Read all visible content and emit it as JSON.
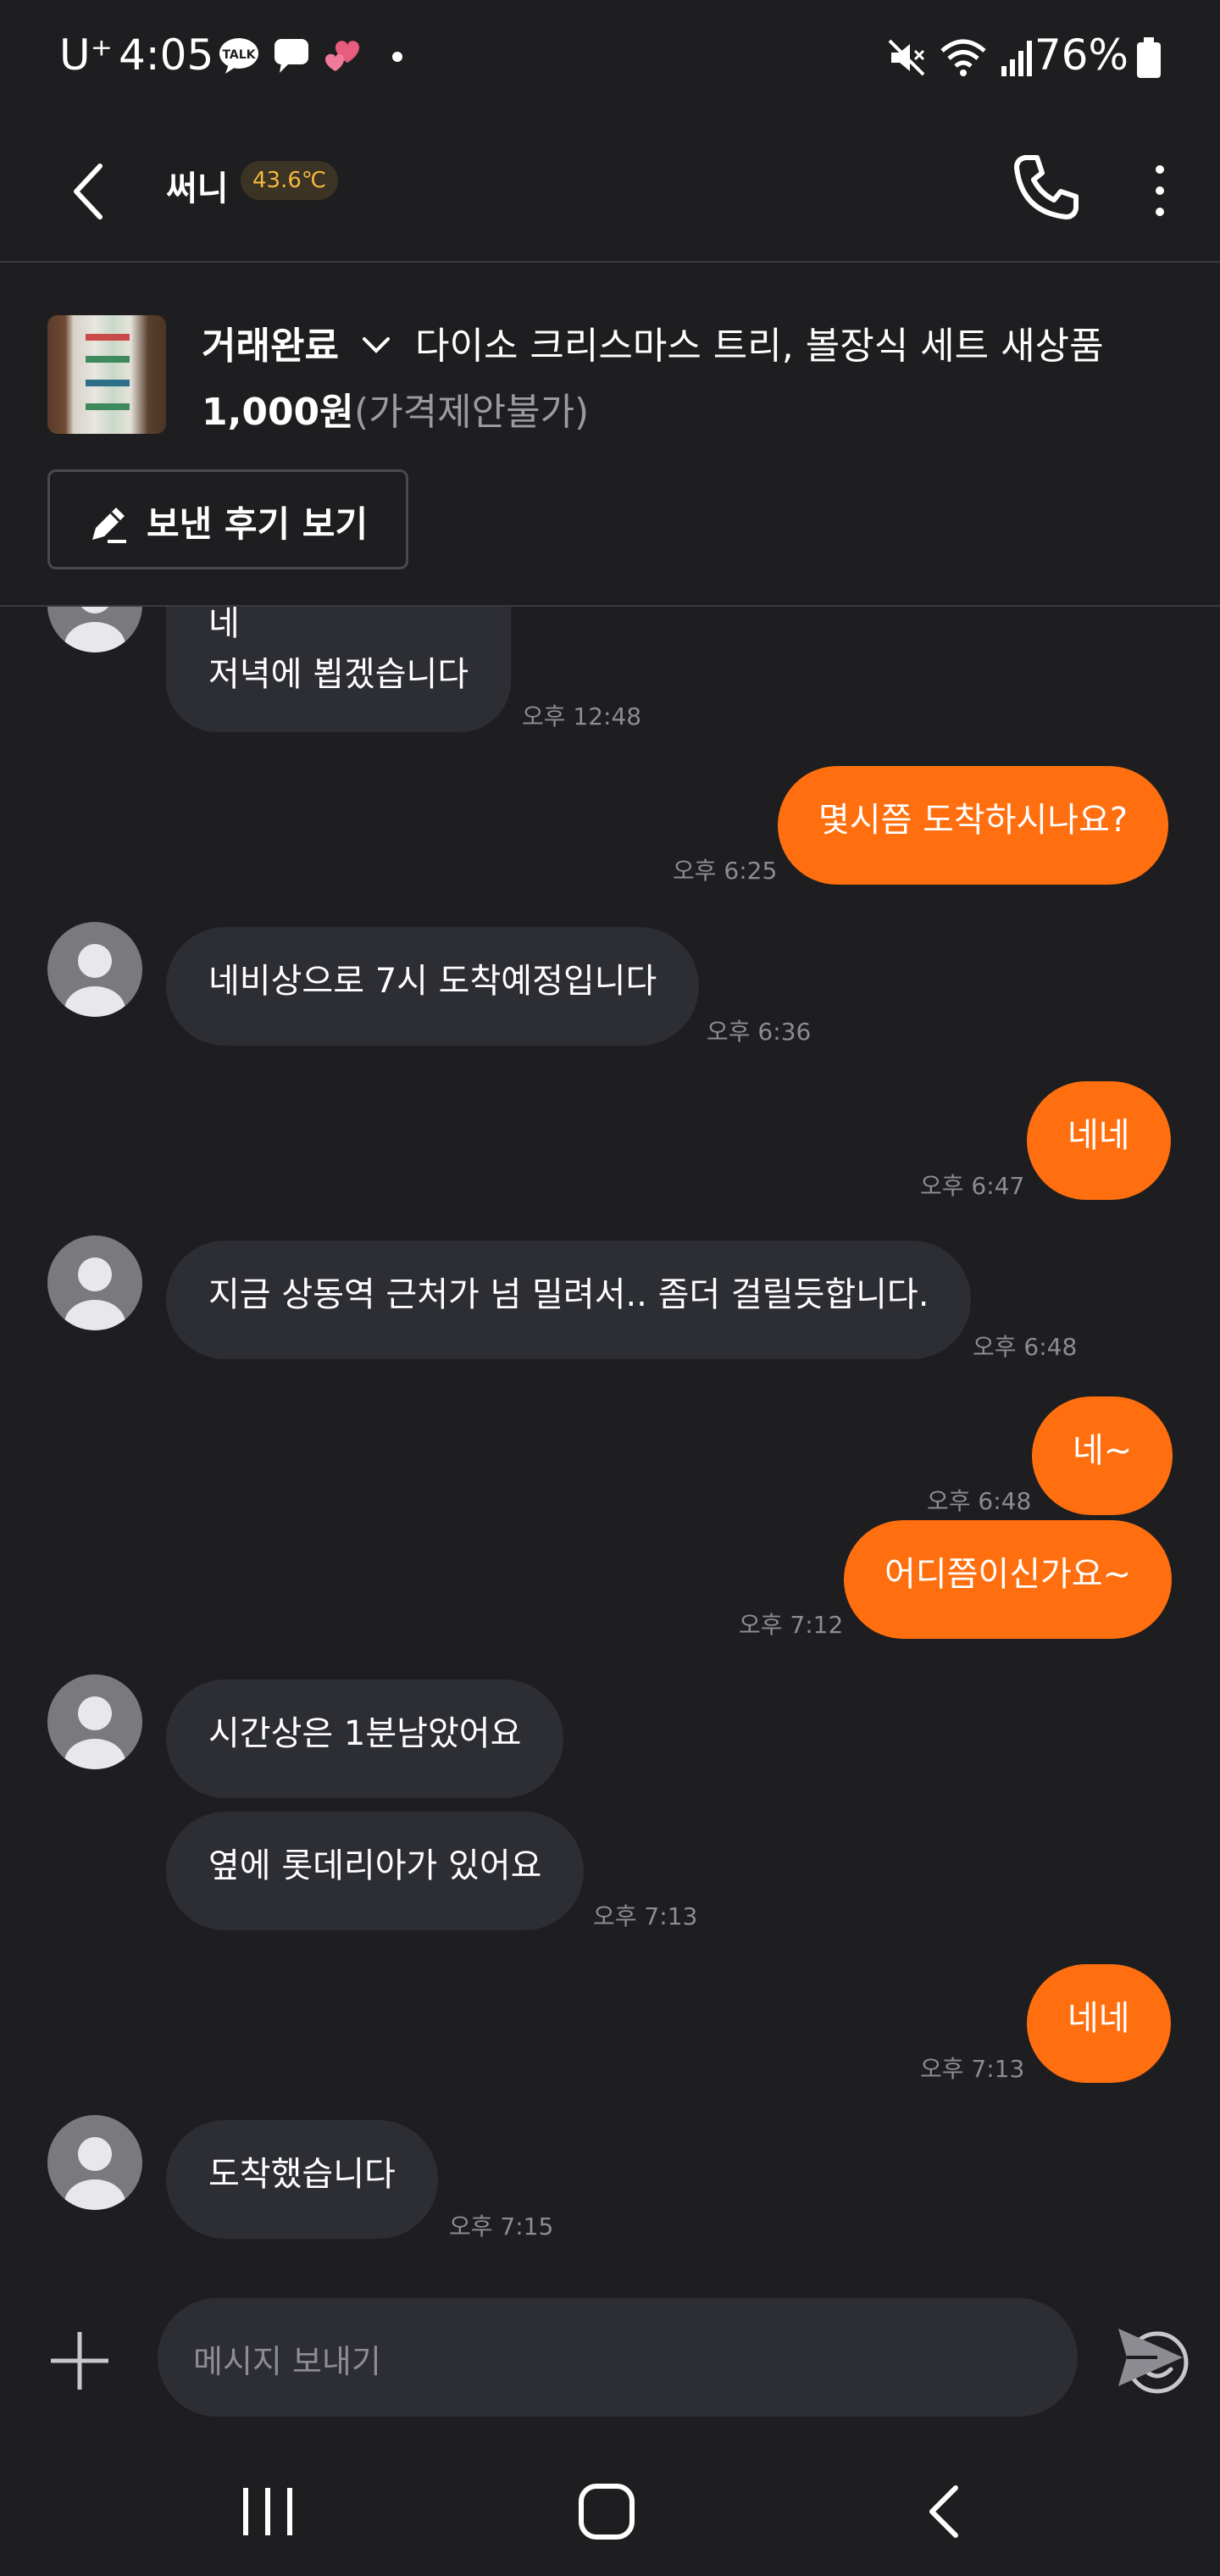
{
  "status_bar": {
    "carrier": "U⁺",
    "time": "4:05",
    "battery": "76%",
    "icons": [
      "talk-icon",
      "chat-icon",
      "hearts-icon",
      "dot-icon",
      "mute-icon",
      "wifi-icon",
      "signal-icon",
      "battery-icon"
    ]
  },
  "header": {
    "name": "써니",
    "temperature": "43.6℃",
    "icons": [
      "back-arrow-icon",
      "phone-icon",
      "more-vertical-icon"
    ]
  },
  "product": {
    "status": "거래완료",
    "title": "다이소 크리스마스 트리, 볼장식 세트 새상품",
    "price": "1,000원",
    "price_note": "(가격제안불가)",
    "review_button": "보낸 후기 보기"
  },
  "messages": [
    {
      "from": "them",
      "lines": [
        "네",
        "저녁에 뵙겠습니다"
      ],
      "time": "오후 12:48"
    },
    {
      "from": "me",
      "text": "몇시쯤 도착하시나요?",
      "time": "오후 6:25"
    },
    {
      "from": "them",
      "text": "네비상으로 7시 도착예정입니다",
      "time": "오후 6:36"
    },
    {
      "from": "me",
      "text": "네네",
      "time": "오후 6:47"
    },
    {
      "from": "them",
      "text": "지금 상동역 근처가 넘 밀려서.. 좀더 걸릴듯합니다.",
      "time": "오후 6:48"
    },
    {
      "from": "me",
      "text": "네~",
      "time": "오후 6:48"
    },
    {
      "from": "me",
      "text": "어디쯤이신가요~",
      "time": "오후 7:12"
    },
    {
      "from": "them",
      "text": "시간상은 1분남았어요"
    },
    {
      "from": "them",
      "text": "옆에 롯데리아가 있어요",
      "time": "오후 7:13"
    },
    {
      "from": "me",
      "text": "네네",
      "time": "오후 7:13"
    },
    {
      "from": "them",
      "text": "도착했습니다",
      "time": "오후 7:15"
    }
  ],
  "input": {
    "placeholder": "메시지 보내기",
    "icons": [
      "plus-icon",
      "emoji-icon",
      "send-icon"
    ]
  },
  "nav_bar": {
    "icons": [
      "recent-apps-icon",
      "home-icon",
      "back-icon"
    ]
  },
  "colors": {
    "background": "#1e1e20",
    "accent": "#ff6f0f",
    "incoming_bubble": "#2d2e33",
    "temperature": "#f5b83d"
  }
}
